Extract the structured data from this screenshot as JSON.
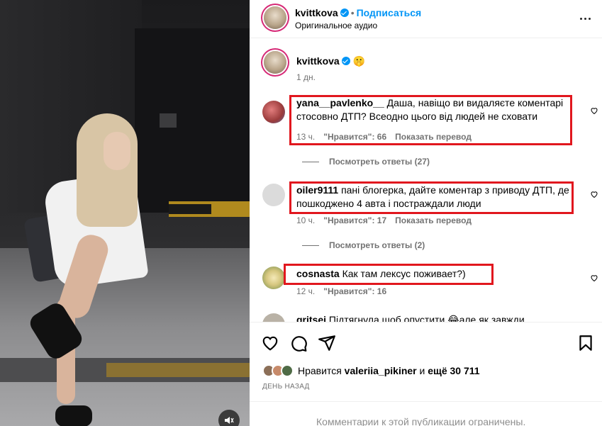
{
  "post": {
    "username": "kvittkova",
    "follow_label": "Подписаться",
    "audio": "Оригинальное аудио",
    "caption_emoji": "🤫",
    "caption_time": "1 дн."
  },
  "comments": [
    {
      "username": "yana__pavlenko__",
      "text": "Даша, навіщо ви видаляєте коментарі стосовно ДТП? Всеодно цього від людей не сховати",
      "time": "13 ч.",
      "likes": "\"Нравится\": 66",
      "translate": "Показать перевод",
      "replies": "Посмотреть ответы (27)"
    },
    {
      "username": "oiler9111",
      "text": "пані блогерка, дайте коментар з приводу ДТП, де пошкоджено 4 авта і постраждали люди",
      "time": "10 ч.",
      "likes": "\"Нравится\": 17",
      "translate": "Показать перевод",
      "replies": "Посмотреть ответы (2)"
    },
    {
      "username": "cosnasta",
      "text": "Как там лексус поживает?)",
      "time": "12 ч.",
      "likes": "\"Нравится\": 16"
    },
    {
      "username": "gritsei",
      "text": "Підтягнула щоб опустити 😂але як завжди"
    }
  ],
  "likes": {
    "prefix": "Нравится",
    "user": "valeriia_pikiner",
    "and": "и",
    "rest": "ещё 30 711"
  },
  "date": "ДЕНЬ НАЗАД",
  "footer": "Комментарии к этой публикации ограничены.",
  "icons": [
    "mute-icon",
    "more-icon",
    "heart-icon",
    "comment-icon",
    "share-icon",
    "save-icon",
    "verified-icon"
  ],
  "colors": {
    "accent": "#0095f6",
    "highlight": "#e1171e"
  }
}
